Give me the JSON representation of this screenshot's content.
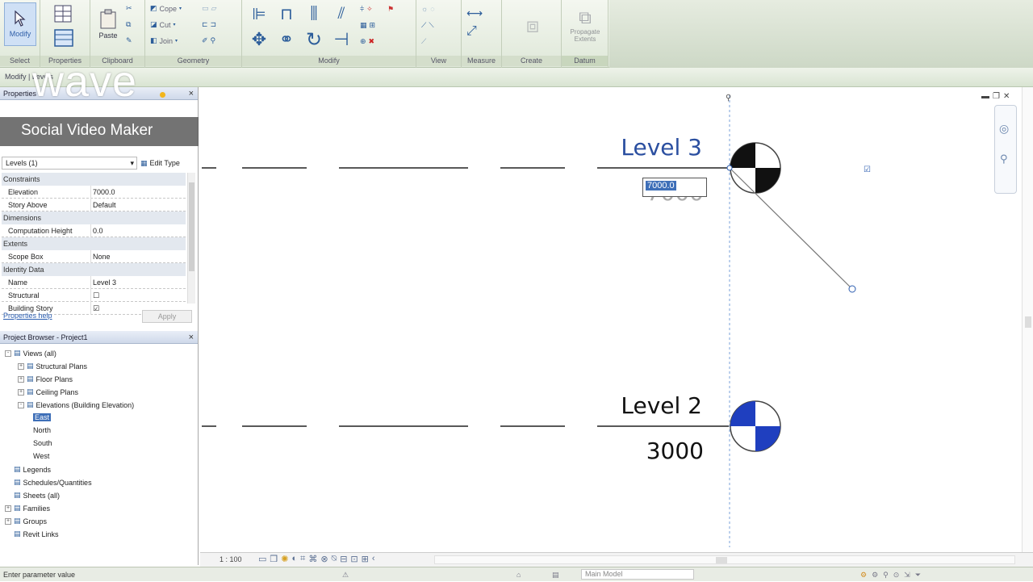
{
  "ribbon": {
    "modify_label": "Modify",
    "paste_label": "Paste",
    "cope_label": "Cope",
    "cut_label": "Cut",
    "join_label": "Join",
    "create_similar_label": "Propagate Extents",
    "groups": [
      {
        "label": "Select"
      },
      {
        "label": "Properties"
      },
      {
        "label": "Clipboard"
      },
      {
        "label": "Geometry"
      },
      {
        "label": "Modify"
      },
      {
        "label": "View"
      },
      {
        "label": "Measure"
      },
      {
        "label": "Create"
      },
      {
        "label": "Datum"
      }
    ]
  },
  "optbar": {
    "context_label": "Modify | Levels"
  },
  "watermark": {
    "brand": "wave",
    "tagline": "Social Video Maker"
  },
  "properties": {
    "title": "Properties",
    "type_selector": "Levels (1)",
    "edit_type": "Edit Type",
    "rows": [
      {
        "kind": "cat",
        "k": "Constraints"
      },
      {
        "kind": "row",
        "k": "Elevation",
        "v": "7000.0"
      },
      {
        "kind": "row",
        "k": "Story Above",
        "v": "Default"
      },
      {
        "kind": "cat",
        "k": "Dimensions"
      },
      {
        "kind": "row",
        "k": "Computation Height",
        "v": "0.0"
      },
      {
        "kind": "cat",
        "k": "Extents"
      },
      {
        "kind": "row",
        "k": "Scope Box",
        "v": "None"
      },
      {
        "kind": "cat",
        "k": "Identity Data"
      },
      {
        "kind": "row",
        "k": "Name",
        "v": "Level 3"
      },
      {
        "kind": "row",
        "k": "Structural",
        "v": "☐"
      },
      {
        "kind": "row",
        "k": "Building Story",
        "v": "☑"
      }
    ],
    "help_link": "Properties help",
    "apply": "Apply"
  },
  "browser": {
    "title": "Project Browser - Project1",
    "items": [
      {
        "label": "Views (all)",
        "indent": 1,
        "expander": "-"
      },
      {
        "label": "Structural Plans",
        "indent": 2,
        "expander": "+"
      },
      {
        "label": "Floor Plans",
        "indent": 2,
        "expander": "+"
      },
      {
        "label": "Ceiling Plans",
        "indent": 2,
        "expander": "+"
      },
      {
        "label": "Elevations (Building Elevation)",
        "indent": 2,
        "expander": "-"
      },
      {
        "label": "East",
        "indent": 3,
        "selected": true
      },
      {
        "label": "North",
        "indent": 3
      },
      {
        "label": "South",
        "indent": 3
      },
      {
        "label": "West",
        "indent": 3
      },
      {
        "label": "Legends",
        "indent": 1,
        "expander": ""
      },
      {
        "label": "Schedules/Quantities",
        "indent": 1,
        "expander": ""
      },
      {
        "label": "Sheets (all)",
        "indent": 1,
        "expander": ""
      },
      {
        "label": "Families",
        "indent": 1,
        "expander": "+"
      },
      {
        "label": "Groups",
        "indent": 1,
        "expander": "+"
      },
      {
        "label": "Revit Links",
        "indent": 1,
        "expander": ""
      }
    ]
  },
  "canvas": {
    "level3": {
      "name": "Level 3",
      "elevation_edit": "7000.0",
      "elevation_behind": "7000"
    },
    "level2": {
      "name": "Level 2",
      "elevation": "3000"
    }
  },
  "viewbar": {
    "scale": "1 : 100"
  },
  "status": {
    "message": "Enter parameter value",
    "model": "Main Model"
  },
  "colors": {
    "level_head_blue": "#1f3fbf",
    "selection_blue": "#3e6fb8",
    "ribbon_green": "#dfe8d9"
  }
}
